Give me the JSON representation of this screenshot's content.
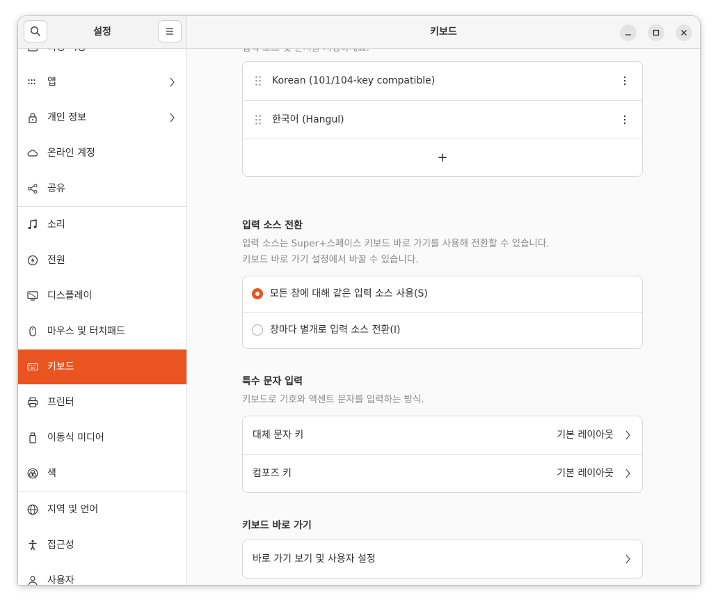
{
  "sidebar": {
    "title": "설정",
    "items": [
      {
        "label": "외형 적용",
        "icon": "appearance-icon"
      },
      {
        "label": "앱",
        "icon": "apps-grid-icon",
        "chevron": true
      },
      {
        "label": "개인 정보",
        "icon": "lock-icon",
        "chevron": true
      },
      {
        "label": "온라인 계정",
        "icon": "cloud-icon"
      },
      {
        "label": "공유",
        "icon": "share-icon"
      },
      {
        "label": "소리",
        "icon": "music-note-icon"
      },
      {
        "label": "전원",
        "icon": "power-icon"
      },
      {
        "label": "디스플레이",
        "icon": "display-icon"
      },
      {
        "label": "마우스 및 터치패드",
        "icon": "mouse-icon"
      },
      {
        "label": "키보드",
        "icon": "keyboard-icon",
        "active": true
      },
      {
        "label": "프린터",
        "icon": "printer-icon"
      },
      {
        "label": "이동식 미디어",
        "icon": "usb-drive-icon"
      },
      {
        "label": "색",
        "icon": "color-icon"
      },
      {
        "label": "지역 및 언어",
        "icon": "globe-icon"
      },
      {
        "label": "접근성",
        "icon": "accessibility-icon"
      },
      {
        "label": "사용자",
        "icon": "users-icon"
      }
    ]
  },
  "main": {
    "title": "키보드",
    "top_partial_text": "입력 소스 및 순서를 지정하세요.",
    "input_sources": [
      "Korean (101/104-key compatible)",
      "한국어 (Hangul)"
    ],
    "add_label": "+",
    "switching": {
      "title": "입력 소스 전환",
      "desc1": "입력 소스는 Super+스페이스 키보드 바로 가기를 사용해 전환할 수 있습니다.",
      "desc2": "키보드 바로 가기 설정에서 바꿀 수 있습니다.",
      "option_same": "모든 창에 대해 같은 입력 소스 사용(S)",
      "option_per_window": "창마다 별개로 입력 소스 전환(I)"
    },
    "special": {
      "title": "특수 문자 입력",
      "desc": "키보드로 기호와 액센트 문자를 입력하는 방식.",
      "alt_chars_label": "대체 문자 키",
      "alt_chars_value": "기본 레이아웃",
      "compose_label": "컴포즈 키",
      "compose_value": "기본 레이아웃"
    },
    "shortcuts": {
      "title": "키보드 바로 가기",
      "view_label": "바로 가기 보기 및 사용자 설정"
    }
  },
  "colors": {
    "accent": "#e95420"
  }
}
